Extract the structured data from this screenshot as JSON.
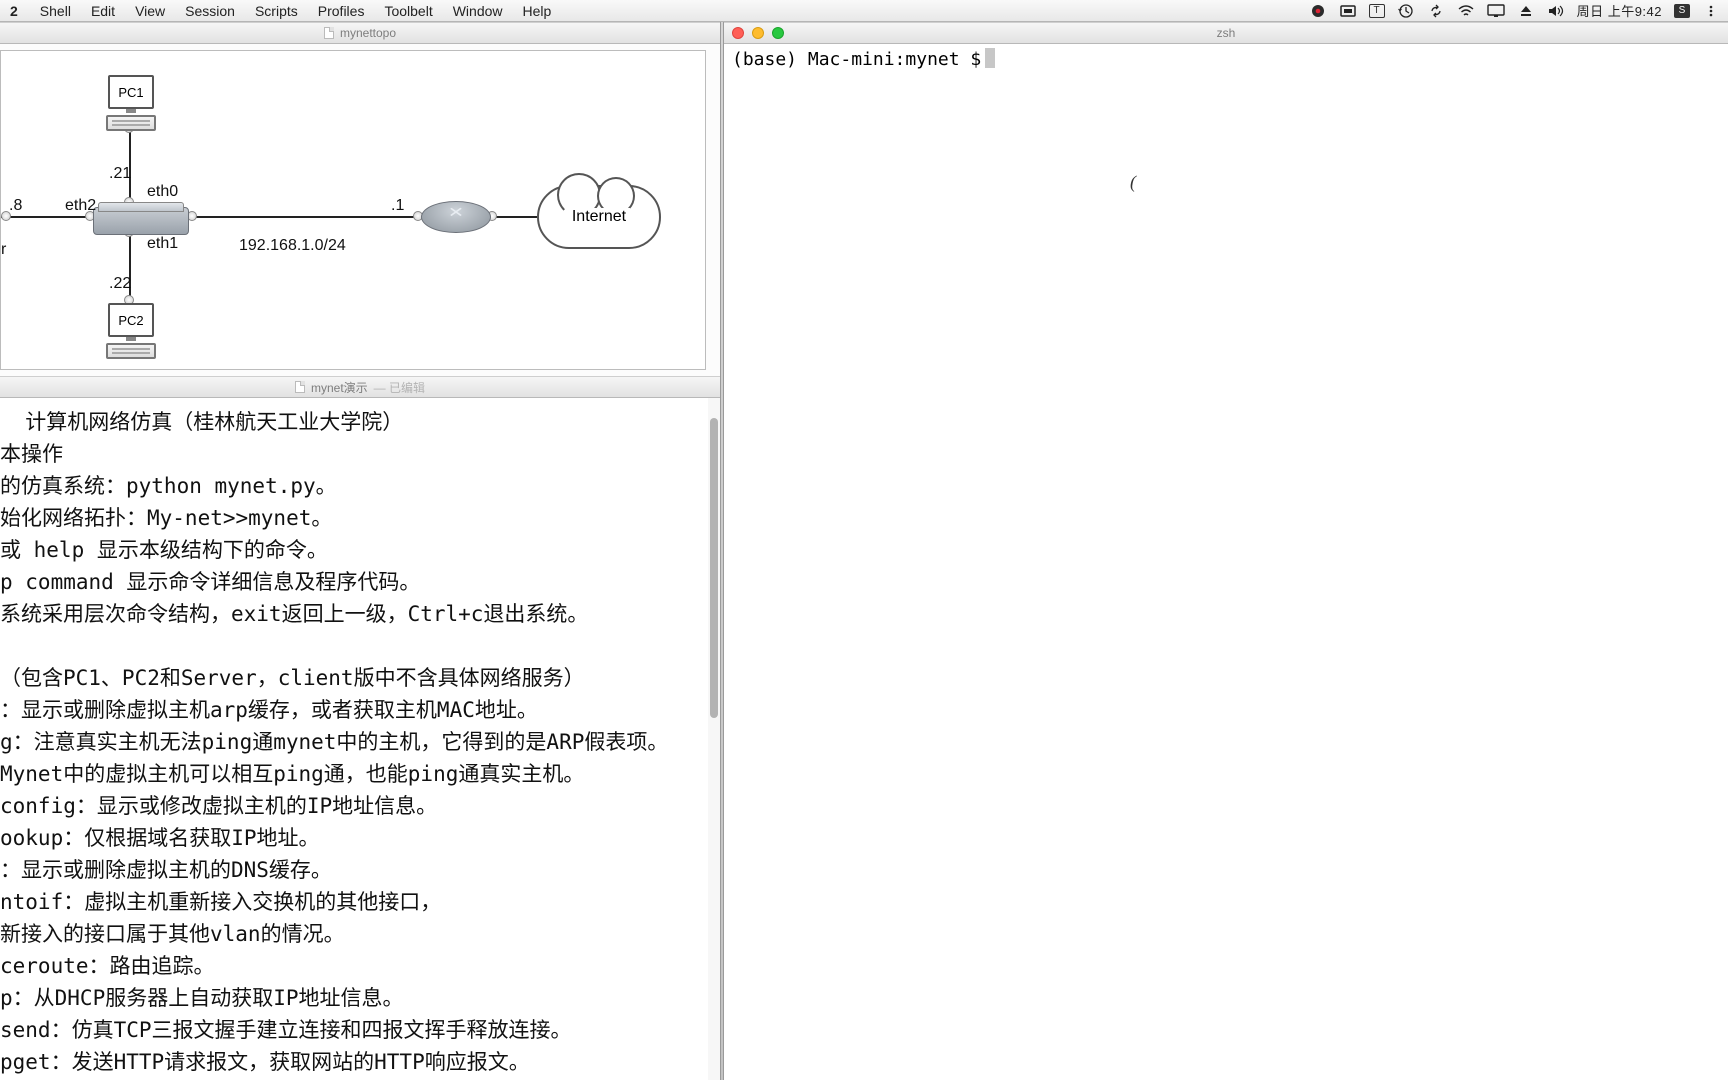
{
  "menubar": {
    "app_suffix": "2",
    "items": [
      "Shell",
      "Edit",
      "View",
      "Session",
      "Scripts",
      "Profiles",
      "Toolbelt",
      "Window",
      "Help"
    ],
    "clock": "周日 上午9:42",
    "ime_letter": "S"
  },
  "topo_window": {
    "title": "mynettopo"
  },
  "topology": {
    "pc1_label": "PC1",
    "pc2_label": "PC2",
    "internet_label": "Internet",
    "subnet": "192.168.1.0/24",
    "if_eth0": "eth0",
    "if_eth1": "eth1",
    "if_eth2": "eth2",
    "addr_8": ".8",
    "addr_21": ".21",
    "addr_22": ".22",
    "addr_1": ".1",
    "addr_r": "r"
  },
  "doc_window": {
    "title": "mynet演示",
    "subtitle": "— 已编辑"
  },
  "doc": {
    "lines": [
      "  计算机网络仿真（桂林航天工业大学院）",
      "本操作",
      "的仿真系统：python mynet.py。",
      "始化网络拓扑：My-net>>mynet。",
      "或 help 显示本级结构下的命令。",
      "p command 显示命令详细信息及程序代码。",
      "系统采用层次命令结构，exit返回上一级，Ctrl+c退出系统。",
      "",
      "（包含PC1、PC2和Server，client版中不含具体网络服务）",
      "：显示或删除虚拟主机arp缓存，或者获取主机MAC地址。",
      "g：注意真实主机无法ping通mynet中的主机，它得到的是ARP假表项。",
      "Mynet中的虚拟主机可以相互ping通，也能ping通真实主机。",
      "config：显示或修改虚拟主机的IP地址信息。",
      "ookup：仅根据域名获取IP地址。",
      "：显示或删除虚拟主机的DNS缓存。",
      "ntoif：虚拟主机重新接入交换机的其他接口，",
      "新接入的接口属于其他vlan的情况。",
      "ceroute：路由追踪。",
      "p：从DHCP服务器上自动获取IP地址信息。",
      "send：仿真TCP三报文握手建立连接和四报文挥手释放连接。",
      "pget：发送HTTP请求报文，获取网站的HTTP响应报文。"
    ]
  },
  "terminal": {
    "title": "zsh",
    "prompt": "(base) Mac-mini:mynet $",
    "caret_mark": "("
  }
}
